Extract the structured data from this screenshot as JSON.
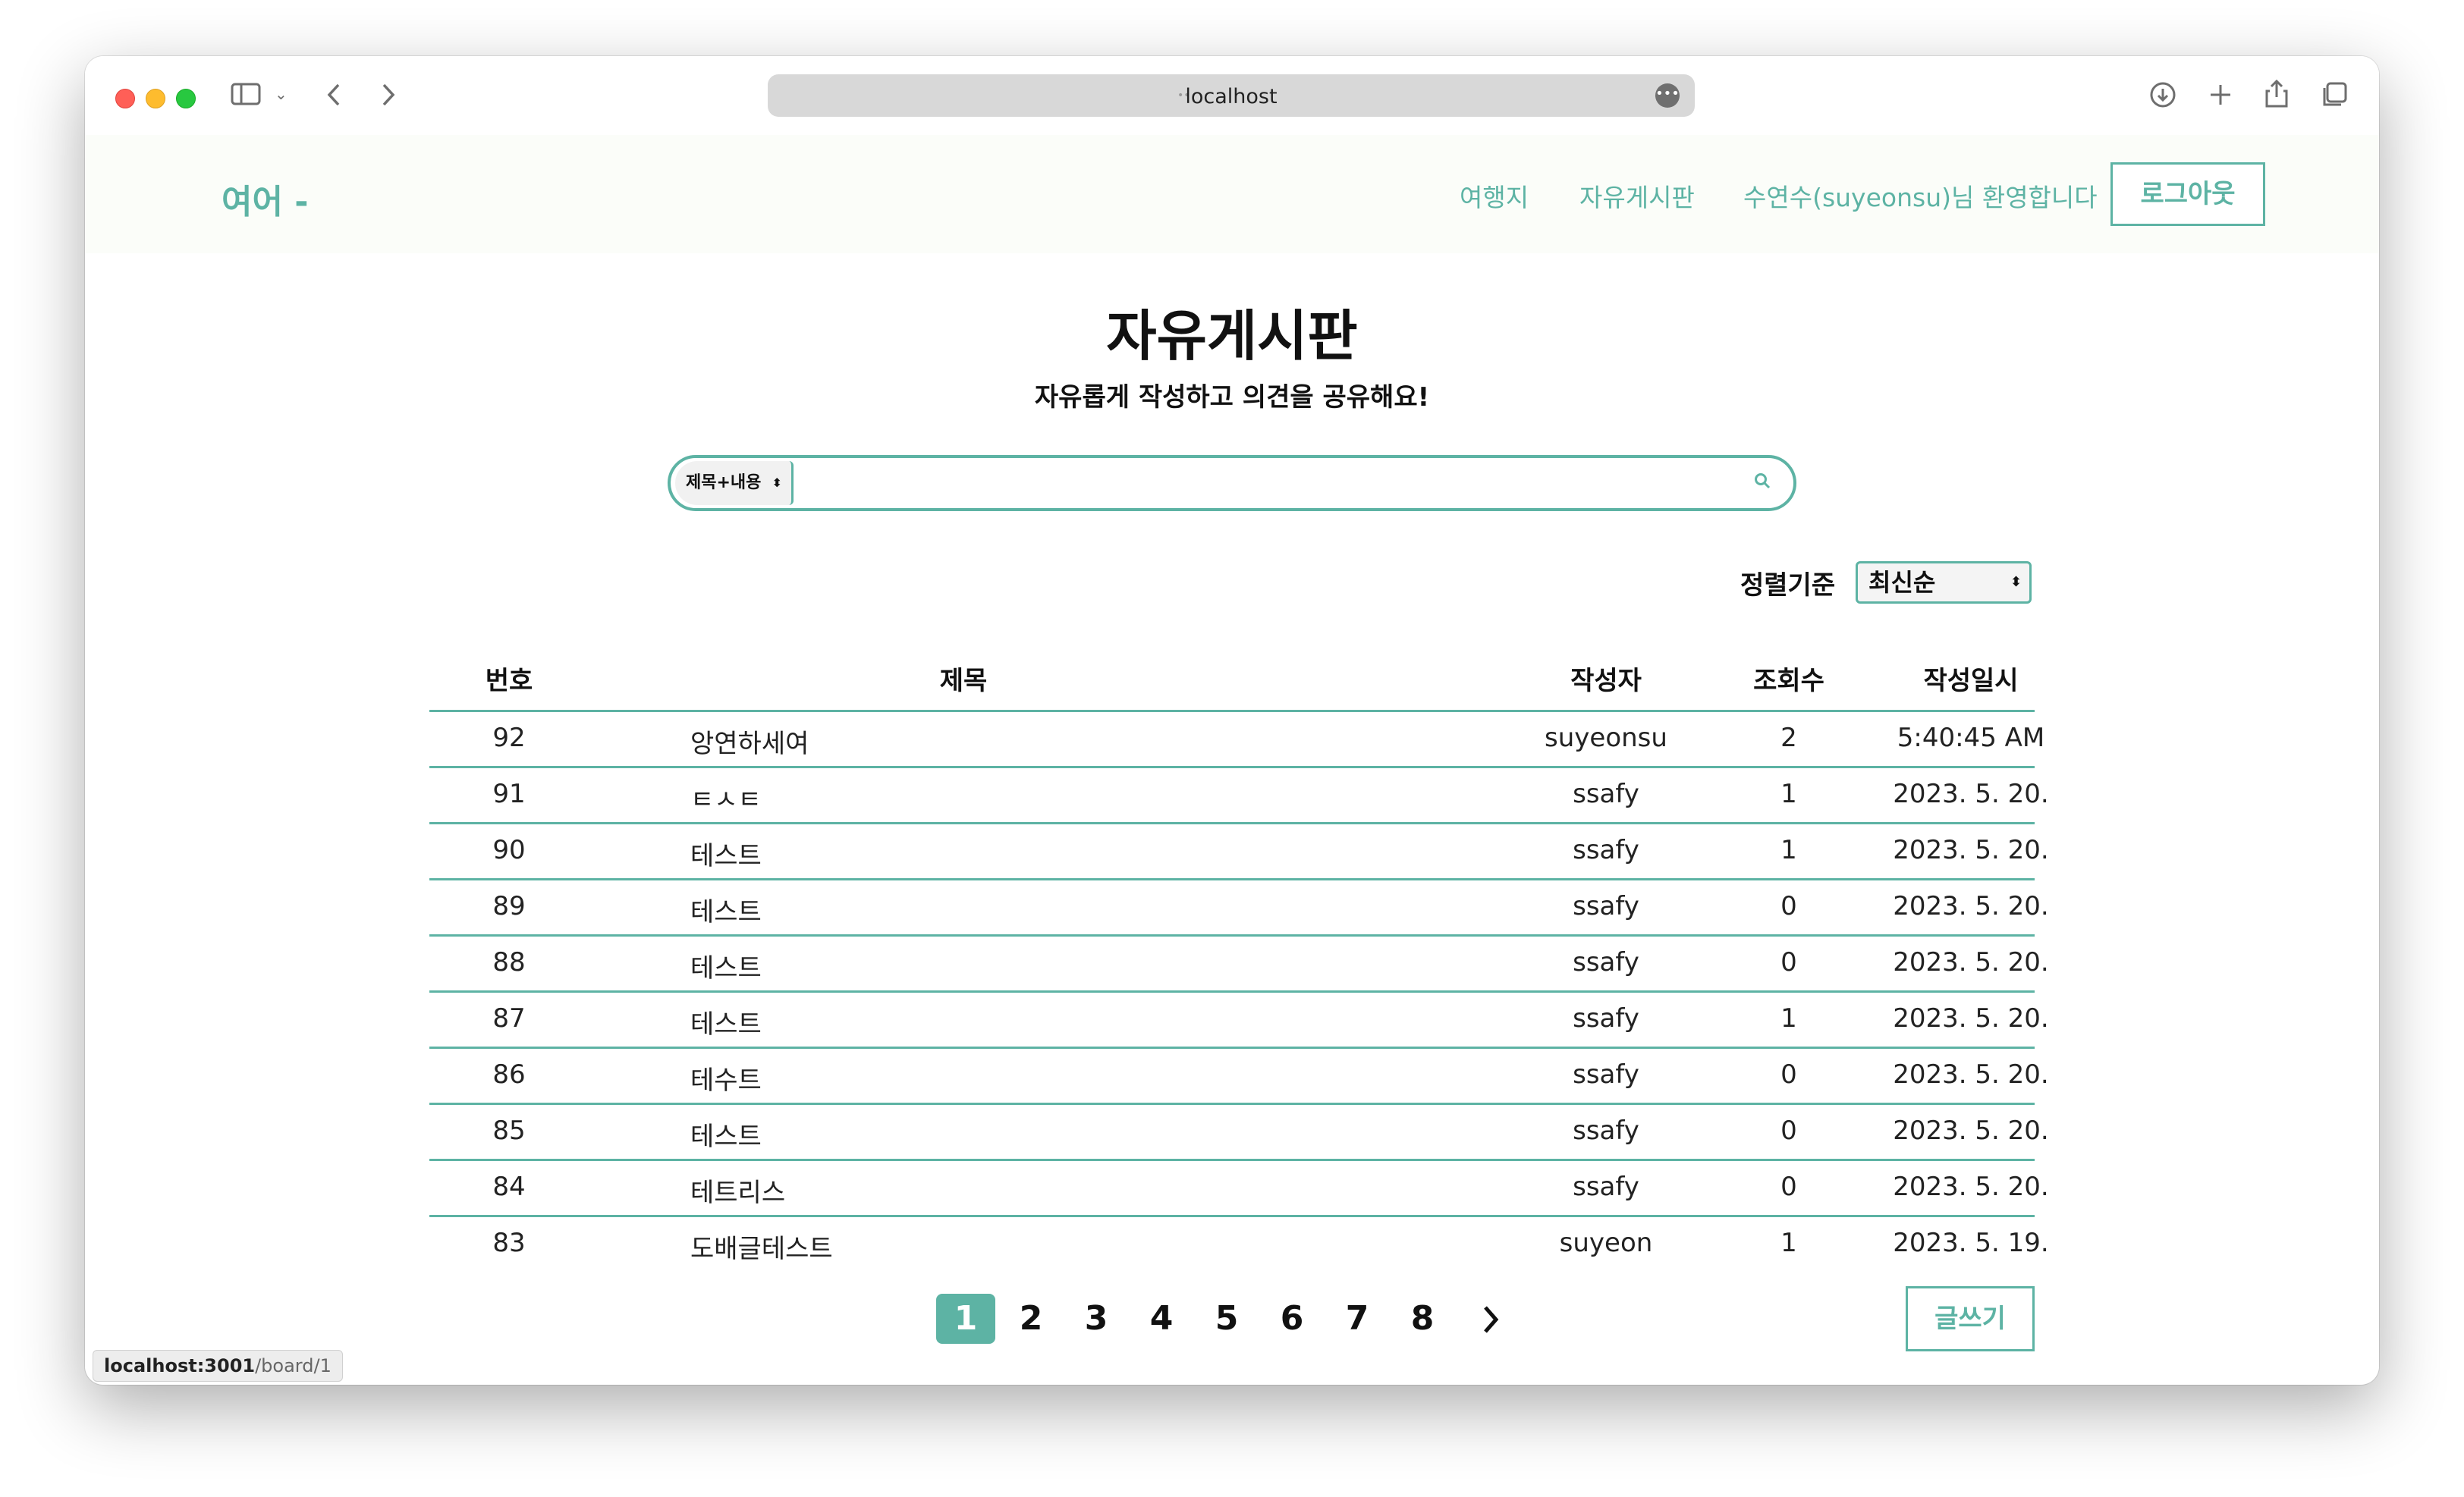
{
  "browser": {
    "url": "localhost",
    "status_host": "localhost:3001",
    "status_path": "/board/1"
  },
  "header": {
    "logo": "여어 -",
    "nav_destinations": "여행지",
    "nav_board": "자유게시판",
    "welcome": "수연수(suyeonsu)님 환영합니다",
    "logout": "로그아웃"
  },
  "page": {
    "title": "자유게시판",
    "subtitle": "자유롭게 작성하고 의견을 공유해요!"
  },
  "search": {
    "scope": "제목+내용",
    "query": ""
  },
  "sort": {
    "label": "정렬기준",
    "value": "최신순"
  },
  "table": {
    "headers": [
      "번호",
      "제목",
      "작성자",
      "조회수",
      "작성일시"
    ],
    "rows": [
      {
        "num": "92",
        "title": "앙연하세여",
        "author": "suyeonsu",
        "views": "2",
        "date": "5:40:45 AM"
      },
      {
        "num": "91",
        "title": "ㅌㅅㅌ",
        "author": "ssafy",
        "views": "1",
        "date": "2023. 5. 20."
      },
      {
        "num": "90",
        "title": "테스트",
        "author": "ssafy",
        "views": "1",
        "date": "2023. 5. 20."
      },
      {
        "num": "89",
        "title": "테스트",
        "author": "ssafy",
        "views": "0",
        "date": "2023. 5. 20."
      },
      {
        "num": "88",
        "title": "테스트",
        "author": "ssafy",
        "views": "0",
        "date": "2023. 5. 20."
      },
      {
        "num": "87",
        "title": "테스트",
        "author": "ssafy",
        "views": "1",
        "date": "2023. 5. 20."
      },
      {
        "num": "86",
        "title": "테수트",
        "author": "ssafy",
        "views": "0",
        "date": "2023. 5. 20."
      },
      {
        "num": "85",
        "title": "테스트",
        "author": "ssafy",
        "views": "0",
        "date": "2023. 5. 20."
      },
      {
        "num": "84",
        "title": "테트리스",
        "author": "ssafy",
        "views": "0",
        "date": "2023. 5. 20."
      },
      {
        "num": "83",
        "title": "도배글테스트",
        "author": "suyeon",
        "views": "1",
        "date": "2023. 5. 19."
      }
    ]
  },
  "pagination": {
    "pages": [
      "1",
      "2",
      "3",
      "4",
      "5",
      "6",
      "7",
      "8"
    ],
    "current": "1",
    "next": "›"
  },
  "write_button": "글쓰기",
  "colors": {
    "accent": "#5db3a4",
    "header_bg": "#fbfdf9"
  }
}
